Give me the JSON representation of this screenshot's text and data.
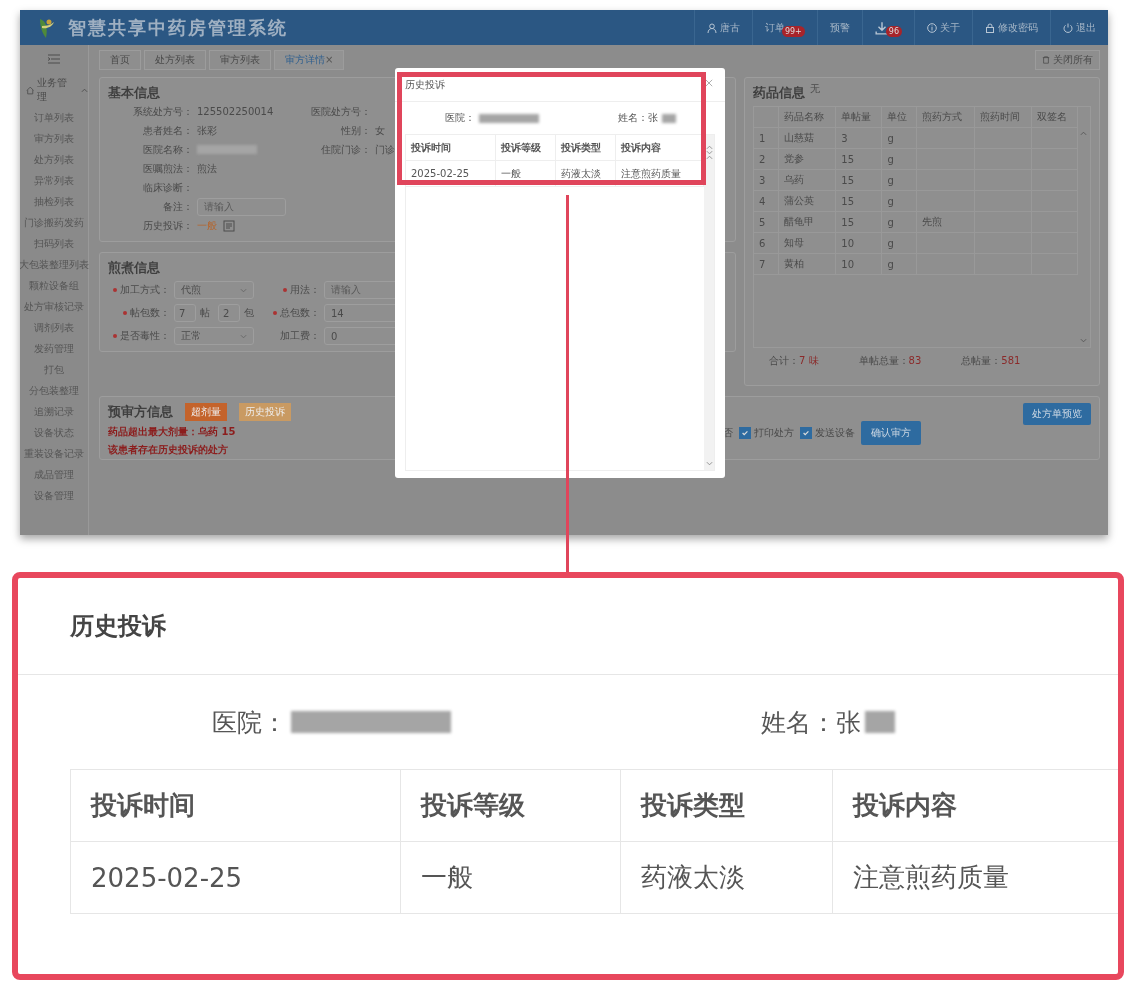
{
  "header": {
    "title": "智慧共享中药房管理系统",
    "nav": [
      {
        "kind": "user",
        "label": "唐古"
      },
      {
        "kind": "text",
        "label": "订单",
        "badge": "99+"
      },
      {
        "kind": "text",
        "label": "预警"
      },
      {
        "kind": "download",
        "badge": "96"
      },
      {
        "kind": "info",
        "label": "关于"
      },
      {
        "kind": "lock",
        "label": "修改密码"
      },
      {
        "kind": "power",
        "label": "退出"
      }
    ]
  },
  "sidebar": {
    "group": {
      "label": "业务管理",
      "expanded": true
    },
    "items": [
      "订单列表",
      "审方列表",
      "处方列表",
      "异常列表",
      "抽检列表",
      "门诊搬药发药",
      "扫码列表",
      "大包装整理列表",
      "颗粒设备组",
      "处方审核记录",
      "调剂列表",
      "发药管理",
      "打包",
      "分包装整理",
      "追溯记录",
      "设备状态",
      "重装设备记录",
      "成品管理",
      "设备管理"
    ]
  },
  "tabs": [
    {
      "label": "首页",
      "selected": false
    },
    {
      "label": "处方列表",
      "selected": false
    },
    {
      "label": "审方列表",
      "selected": false
    },
    {
      "label": "审方详情",
      "selected": true,
      "close_glyph": "×"
    }
  ],
  "close_all_button": "关闭所有",
  "basic_info": {
    "title": "基本信息",
    "rows": [
      [
        {
          "kind": "text",
          "label": "系统处方号：",
          "value": "125502250014"
        },
        {
          "kind": "text",
          "label": "医院处方号："
        }
      ],
      [
        {
          "kind": "text",
          "label": "患者姓名：",
          "value": "张彩"
        },
        {
          "kind": "text",
          "label": "性别：",
          "value": "女"
        }
      ],
      [
        {
          "kind": "redacted",
          "label": "医院名称："
        },
        {
          "kind": "text",
          "label": "住院门诊：",
          "value": "门诊"
        }
      ],
      [
        {
          "kind": "text",
          "label": "医嘱煎法：",
          "value": "煎法"
        }
      ],
      [
        {
          "kind": "text",
          "label": "临床诊断："
        }
      ],
      [
        {
          "kind": "input",
          "label": "备注：",
          "placeholder": "请输入"
        }
      ],
      [
        {
          "kind": "complaint",
          "label": "历史投诉：",
          "value": "一般"
        }
      ]
    ]
  },
  "decoct_info": {
    "title": "煎煮信息",
    "fields": [
      {
        "kind": "select",
        "required": true,
        "label": "加工方式：",
        "value": "代煎"
      },
      {
        "kind": "input",
        "required": true,
        "label": "用法：",
        "placeholder": "请输入"
      },
      {
        "kind": "pair",
        "required": true,
        "label": "帖包数：",
        "value": "7",
        "unit": "帖",
        "value2": "2",
        "unit2": "包"
      },
      {
        "kind": "input",
        "required": true,
        "label": "总包数：",
        "value": "14"
      },
      {
        "kind": "select",
        "required": true,
        "label": "是否毒性：",
        "value": "正常"
      },
      {
        "kind": "input",
        "required": false,
        "label": "加工费：",
        "value": "0"
      }
    ]
  },
  "drug_info": {
    "title": "药品信息",
    "note": "无",
    "columns": [
      "",
      "药品名称",
      "单帖量",
      "单位",
      "煎药方式",
      "煎药时间",
      "双签名"
    ],
    "rows": [
      [
        "1",
        "山慈菇",
        "3",
        "g",
        "",
        "",
        ""
      ],
      [
        "2",
        "党参",
        "15",
        "g",
        "",
        "",
        ""
      ],
      [
        "3",
        "乌药",
        "15",
        "g",
        "",
        "",
        ""
      ],
      [
        "4",
        "蒲公英",
        "15",
        "g",
        "",
        "",
        ""
      ],
      [
        "5",
        "醋龟甲",
        "15",
        "g",
        "先煎",
        "",
        ""
      ],
      [
        "6",
        "知母",
        "10",
        "g",
        "",
        "",
        ""
      ],
      [
        "7",
        "黄柏",
        "10",
        "g",
        "",
        "",
        ""
      ]
    ],
    "summary": [
      {
        "label": "合计：",
        "value": "7 味"
      },
      {
        "label": "单帖总量：",
        "value": "83"
      },
      {
        "label": "总帖量：",
        "value": "581"
      }
    ]
  },
  "prereview": {
    "title": "预审方信息",
    "tags": [
      {
        "label": "超剂量",
        "color": "#c4632b"
      },
      {
        "label": "历史投诉",
        "color": "#c99a62"
      }
    ],
    "messages": [
      "药品超出最大剂量：乌药 15",
      "该患者存在历史投诉的处方"
    ],
    "preview_button": "处方单预览",
    "label_fragment": "否",
    "checkboxes": [
      {
        "label": "打印处方",
        "checked": true
      },
      {
        "label": "发送设备",
        "checked": true
      }
    ],
    "confirm_button": "确认审方"
  },
  "modal": {
    "title": "历史投诉",
    "hospital_label": "医院：",
    "name_label": "姓名：张",
    "columns": [
      "投诉时间",
      "投诉等级",
      "投诉类型",
      "投诉内容"
    ],
    "rows": [
      [
        "2025-02-25",
        "一般",
        "药液太淡",
        "注意煎药质量"
      ]
    ]
  },
  "callout": {
    "title": "历史投诉",
    "hospital_label": "医院：",
    "name_label": "姓名：张",
    "columns": [
      "投诉时间",
      "投诉等级",
      "投诉类型",
      "投诉内容"
    ],
    "rows": [
      [
        "2025-02-25",
        "一般",
        "药液太淡",
        "注意煎药质量"
      ]
    ]
  }
}
